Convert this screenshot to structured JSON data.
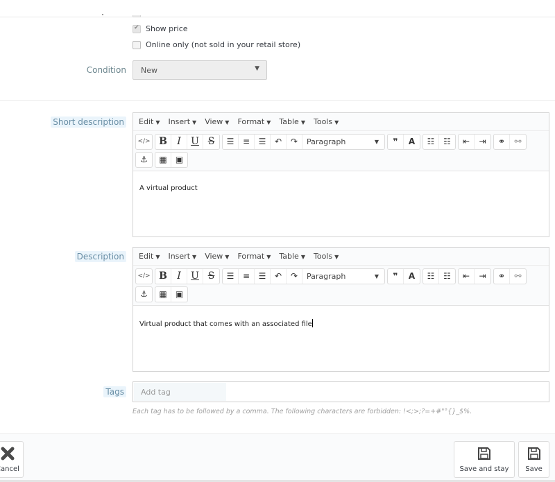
{
  "options": {
    "show_price": {
      "label": "Show price",
      "checked": true
    },
    "online_only": {
      "label": "Online only (not sold in your retail store)",
      "checked": false
    }
  },
  "condition": {
    "label": "Condition",
    "value": "New"
  },
  "editor_menu": [
    "Edit",
    "Insert",
    "View",
    "Format",
    "Table",
    "Tools"
  ],
  "editor_toolbar": {
    "source_code": "</>",
    "bold": "B",
    "italic": "I",
    "underline": "U",
    "strikethrough": "S",
    "block_format": "Paragraph",
    "blockquote": "❞",
    "text_color": "A"
  },
  "short_description": {
    "label": "Short description",
    "content": "A virtual product"
  },
  "description": {
    "label": "Description",
    "content": "Virtual product that comes with an associated file"
  },
  "tags": {
    "label": "Tags",
    "placeholder": "Add tag",
    "help": "Each tag has to be followed by a comma. The following characters are forbidden: !<;>;?=+#\"°{}_$%."
  },
  "footer": {
    "cancel_label": "Cancel",
    "save_and_stay_label": "Save and stay",
    "save_label": "Save"
  }
}
